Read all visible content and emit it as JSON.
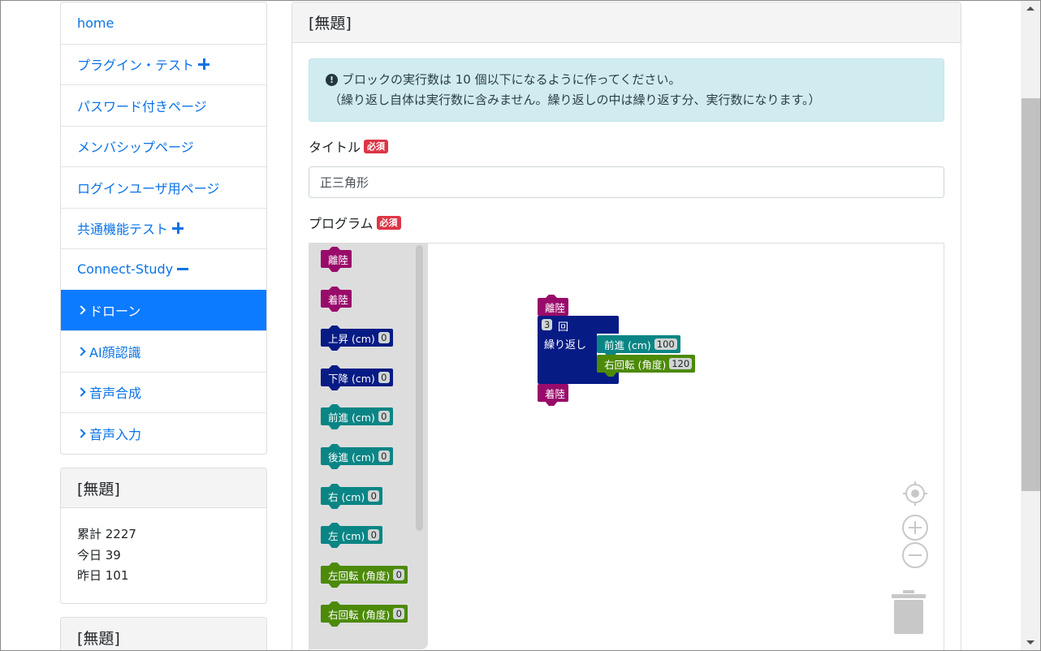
{
  "nav": {
    "items": [
      {
        "label": "home"
      },
      {
        "label": "プラグイン・テスト"
      },
      {
        "label": "パスワード付きページ"
      },
      {
        "label": "メンバシップページ"
      },
      {
        "label": "ログインユーザ用ページ"
      },
      {
        "label": "共通機能テスト"
      },
      {
        "label": "Connect-Study"
      },
      {
        "label": "ドローン"
      },
      {
        "label": "AI顔認識"
      },
      {
        "label": "音声合成"
      },
      {
        "label": "音声入力"
      }
    ]
  },
  "counter_card": {
    "title": "[無題]",
    "total": "累計 2227",
    "today": "今日 39",
    "yesterday": "昨日 101"
  },
  "bottom_card": {
    "title": "[無題]"
  },
  "main": {
    "title": "[無題]",
    "alert_line1": "ブロックの実行数は 10 個以下になるように作ってください。",
    "alert_line2": "（繰り返し自体は実行数に含みません。繰り返しの中は繰り返す分、実行数になります。）",
    "title_label": "タイトル",
    "required": "必須",
    "title_value": "正三角形",
    "program_label": "プログラム"
  },
  "flyout": {
    "blocks": [
      {
        "label": "離陸",
        "value": "",
        "color": "#990b6a"
      },
      {
        "label": "着陸",
        "value": "",
        "color": "#990b6a"
      },
      {
        "label": "上昇 (cm)",
        "value": "0",
        "color": "#071b85"
      },
      {
        "label": "下降 (cm)",
        "value": "0",
        "color": "#071b85"
      },
      {
        "label": "前進 (cm)",
        "value": "0",
        "color": "#0a8585"
      },
      {
        "label": "後進 (cm)",
        "value": "0",
        "color": "#0a8585"
      },
      {
        "label": "右 (cm)",
        "value": "0",
        "color": "#0a8585"
      },
      {
        "label": "左 (cm)",
        "value": "0",
        "color": "#0a8585"
      },
      {
        "label": "左回転 (角度)",
        "value": "0",
        "color": "#4c8a08"
      },
      {
        "label": "右回転 (角度)",
        "value": "0",
        "color": "#4c8a08"
      }
    ]
  },
  "program": {
    "takeoff": "離陸",
    "repeat_count": "3",
    "repeat_unit": "回",
    "repeat_label": "繰り返し",
    "forward_label": "前進 (cm)",
    "forward_value": "100",
    "turn_label": "右回転 (角度)",
    "turn_value": "120",
    "land": "着陸"
  }
}
